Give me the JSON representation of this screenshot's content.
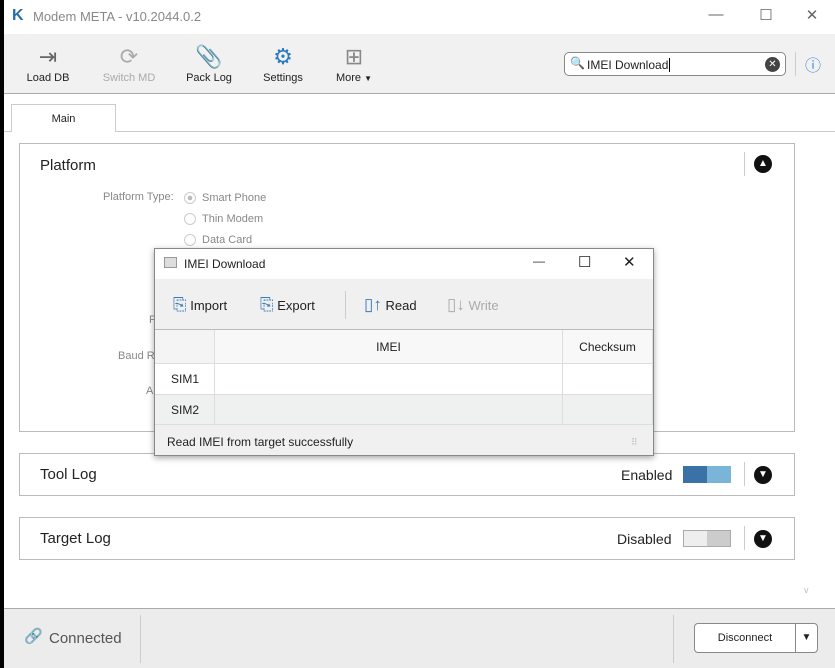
{
  "window": {
    "title": "Modem META - v10.2044.0.2"
  },
  "toolbar": {
    "items": [
      {
        "label": "Load DB",
        "icon": "load-db-icon"
      },
      {
        "label": "Switch MD",
        "icon": "switch-icon",
        "disabled": true
      },
      {
        "label": "Pack Log",
        "icon": "paperclip-icon"
      },
      {
        "label": "Settings",
        "icon": "gear-icon"
      },
      {
        "label": "More",
        "icon": "grid-icon"
      }
    ],
    "search_value": "IMEI Download"
  },
  "tabs": [
    {
      "label": "Main"
    }
  ],
  "platform": {
    "title": "Platform",
    "type_label": "Platform Type:",
    "options": [
      "Smart Phone",
      "Thin Modem",
      "Data Card"
    ],
    "selected": "Smart Phone",
    "hidden_labels": [
      "P",
      "Baud R",
      "A"
    ]
  },
  "tool_log": {
    "title": "Tool Log",
    "state": "Enabled"
  },
  "target_log": {
    "title": "Target Log",
    "state": "Disabled"
  },
  "dialog": {
    "title": "IMEI Download",
    "buttons": [
      "Import",
      "Export",
      "Read",
      "Write"
    ],
    "columns": [
      "IMEI",
      "Checksum"
    ],
    "rows": [
      {
        "label": "SIM1",
        "imei": "",
        "checksum": ""
      },
      {
        "label": "SIM2",
        "imei": "",
        "checksum": ""
      }
    ],
    "status": "Read IMEI from target successfully"
  },
  "statusbar": {
    "connection": "Connected",
    "disconnect_label": "Disconnect"
  },
  "colors": {
    "accent": "#3a72a8",
    "toggle_on": "#7ab4d8"
  }
}
